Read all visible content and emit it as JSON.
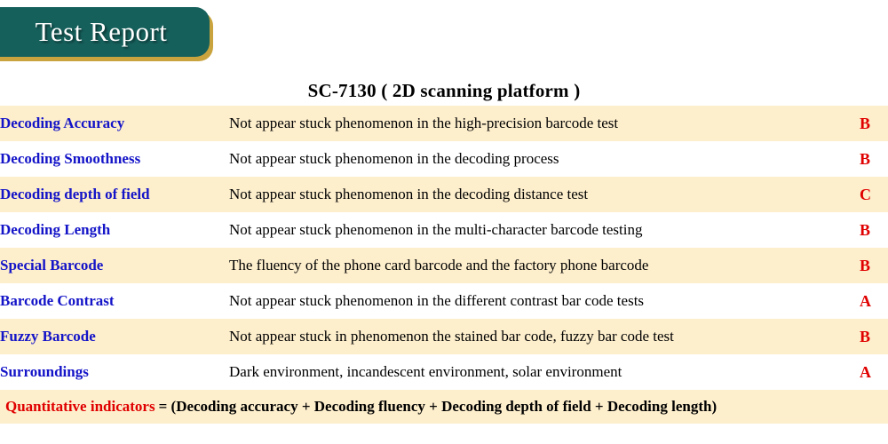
{
  "banner": {
    "title": "Test Report",
    "body_color": "#16605c",
    "shadow_color": "#c9a43e",
    "text_color": "#ffffff"
  },
  "heading": "SC-7130 ( 2D scanning platform )",
  "table": {
    "item_color": "#1414c8",
    "desc_color": "#000000",
    "grade_color": "#e00000",
    "band_color": "#fdeecc",
    "rows": [
      {
        "item": "Decoding Accuracy",
        "description": "Not appear stuck phenomenon in the high-precision barcode test",
        "grade": "B"
      },
      {
        "item": "Decoding Smoothness",
        "description": "Not appear stuck phenomenon in the decoding process",
        "grade": "B"
      },
      {
        "item": "Decoding depth of field",
        "description": "Not appear stuck phenomenon in the decoding distance test",
        "grade": "C"
      },
      {
        "item": "Decoding Length",
        "description": "Not appear stuck phenomenon in the multi-character barcode testing",
        "grade": "B"
      },
      {
        "item": "Special Barcode",
        "description": "The fluency of the phone card barcode and the factory phone barcode",
        "grade": "B"
      },
      {
        "item": "Barcode Contrast",
        "description": "Not appear stuck phenomenon in the different contrast bar code tests",
        "grade": "A"
      },
      {
        "item": "Fuzzy Barcode",
        "description": "Not appear stuck in phenomenon the stained bar code, fuzzy bar code test",
        "grade": "B"
      },
      {
        "item": "Surroundings",
        "description": "Dark environment, incandescent environment, solar environment",
        "grade": "A"
      }
    ]
  },
  "footer": {
    "label": "Quantitative indicators",
    "formula": "= (Decoding accuracy + Decoding fluency + Decoding depth of field + Decoding length)"
  }
}
